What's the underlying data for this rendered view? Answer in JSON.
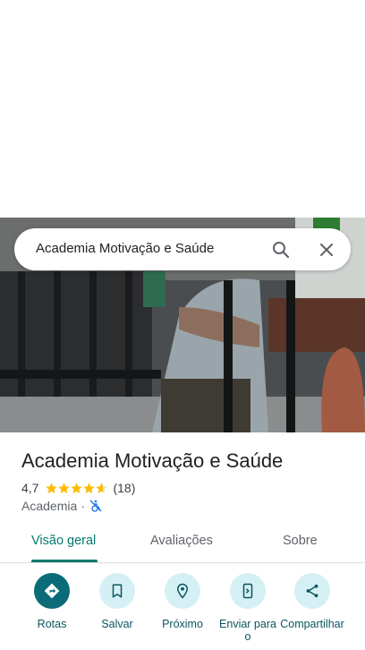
{
  "search": {
    "query": "Academia Motivação e Saúde"
  },
  "place": {
    "name": "Academia Motivação e Saúde",
    "rating": "4,7",
    "rating_value": 4.7,
    "review_count": "(18)",
    "category": "Academia",
    "separator": "·"
  },
  "tabs": [
    {
      "label": "Visão geral",
      "active": true
    },
    {
      "label": "Avaliações",
      "active": false
    },
    {
      "label": "Sobre",
      "active": false
    }
  ],
  "actions": [
    {
      "label": "Rotas",
      "icon": "directions-icon"
    },
    {
      "label": "Salvar",
      "icon": "bookmark-icon"
    },
    {
      "label": "Próximo",
      "icon": "nearby-icon"
    },
    {
      "label": "Enviar para o",
      "icon": "send-to-phone-icon"
    },
    {
      "label": "Compartilhar",
      "icon": "share-icon"
    }
  ],
  "colors": {
    "accent": "#00796b",
    "action_bg": "#d5f0f4",
    "primary_action": "#0b6b78",
    "star": "#fbbc04"
  }
}
